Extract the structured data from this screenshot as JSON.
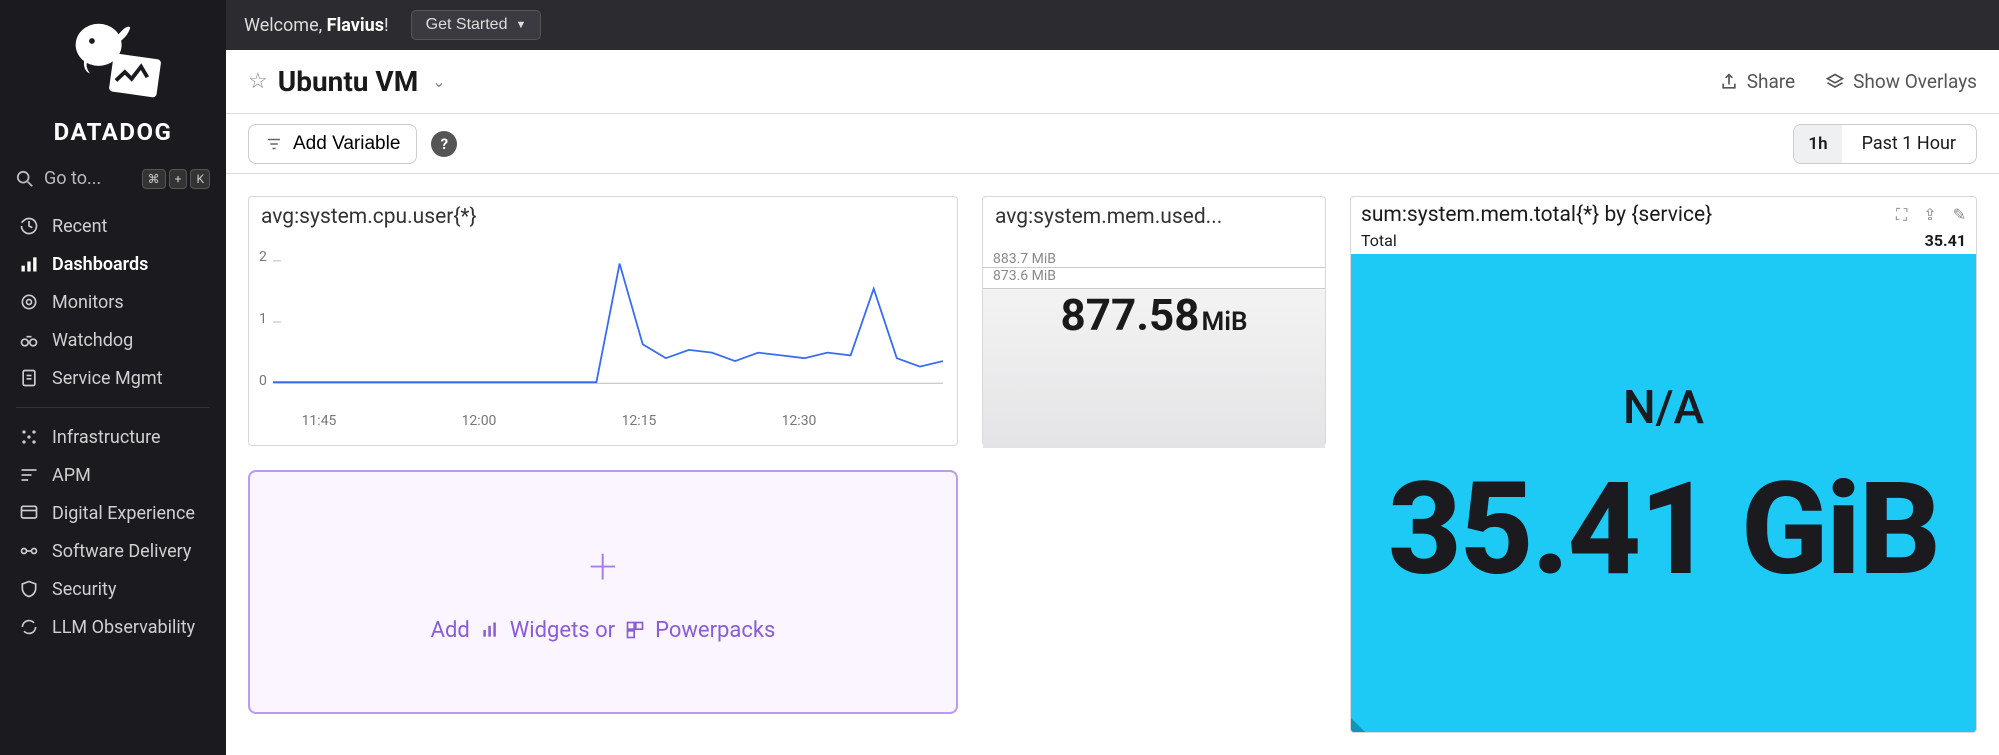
{
  "brand": {
    "name": "DATADOG"
  },
  "search": {
    "label": "Go to...",
    "shortcut_mod": "⌘",
    "shortcut_plus": "+",
    "shortcut_key": "K"
  },
  "nav": {
    "group1": [
      {
        "label": "Recent"
      },
      {
        "label": "Dashboards",
        "active": true
      },
      {
        "label": "Monitors"
      },
      {
        "label": "Watchdog"
      },
      {
        "label": "Service Mgmt"
      }
    ],
    "group2": [
      {
        "label": "Infrastructure"
      },
      {
        "label": "APM"
      },
      {
        "label": "Digital Experience"
      },
      {
        "label": "Software Delivery"
      },
      {
        "label": "Security"
      },
      {
        "label": "LLM Observability"
      }
    ]
  },
  "topbar": {
    "welcome_pre": "Welcome, ",
    "welcome_name": "Flavius",
    "welcome_post": "!",
    "get_started": "Get Started"
  },
  "header": {
    "title": "Ubuntu VM",
    "share": "Share",
    "overlays": "Show Overlays"
  },
  "varbar": {
    "add_variable": "Add Variable",
    "time_short": "1h",
    "time_label": "Past 1 Hour"
  },
  "widgets": {
    "cpu": {
      "title": "avg:system.cpu.user{*}"
    },
    "mem_used": {
      "title": "avg:system.mem.used...",
      "tick_upper": "883.7 MiB",
      "tick_lower": "873.6 MiB",
      "value": "877.58",
      "unit": "MiB"
    },
    "mem_total": {
      "title": "sum:system.mem.total{*} by {service}",
      "row_label": "Total",
      "row_value": "35.41",
      "na": "N/A",
      "big": "35.41 GiB"
    },
    "dropzone": {
      "add": "Add",
      "widgets_or": "Widgets or",
      "powerpacks": "Powerpacks"
    }
  },
  "chart_data": {
    "type": "line",
    "title": "avg:system.cpu.user{*}",
    "xlabel": "",
    "ylabel": "",
    "ylim": [
      0,
      2.2
    ],
    "x_ticks": [
      "11:45",
      "12:00",
      "12:15",
      "12:30"
    ],
    "y_ticks": [
      0,
      1,
      2
    ],
    "series": [
      {
        "name": "avg:system.cpu.user{*}",
        "t": [
          "11:45",
          "11:48",
          "11:51",
          "11:54",
          "11:57",
          "12:00",
          "12:03",
          "12:06",
          "12:09",
          "12:12",
          "12:15",
          "12:18",
          "12:21",
          "12:24",
          "12:27",
          "12:28",
          "12:29",
          "12:30",
          "12:31",
          "12:32",
          "12:33",
          "12:34",
          "12:35",
          "12:36",
          "12:37",
          "12:38",
          "12:39",
          "12:40",
          "12:41",
          "12:42"
        ],
        "y": [
          0.02,
          0.02,
          0.02,
          0.02,
          0.02,
          0.02,
          0.02,
          0.02,
          0.02,
          0.02,
          0.02,
          0.02,
          0.02,
          0.02,
          0.02,
          2.15,
          0.7,
          0.45,
          0.6,
          0.55,
          0.4,
          0.55,
          0.5,
          0.45,
          0.55,
          0.5,
          1.7,
          0.45,
          0.3,
          0.4
        ]
      }
    ]
  }
}
